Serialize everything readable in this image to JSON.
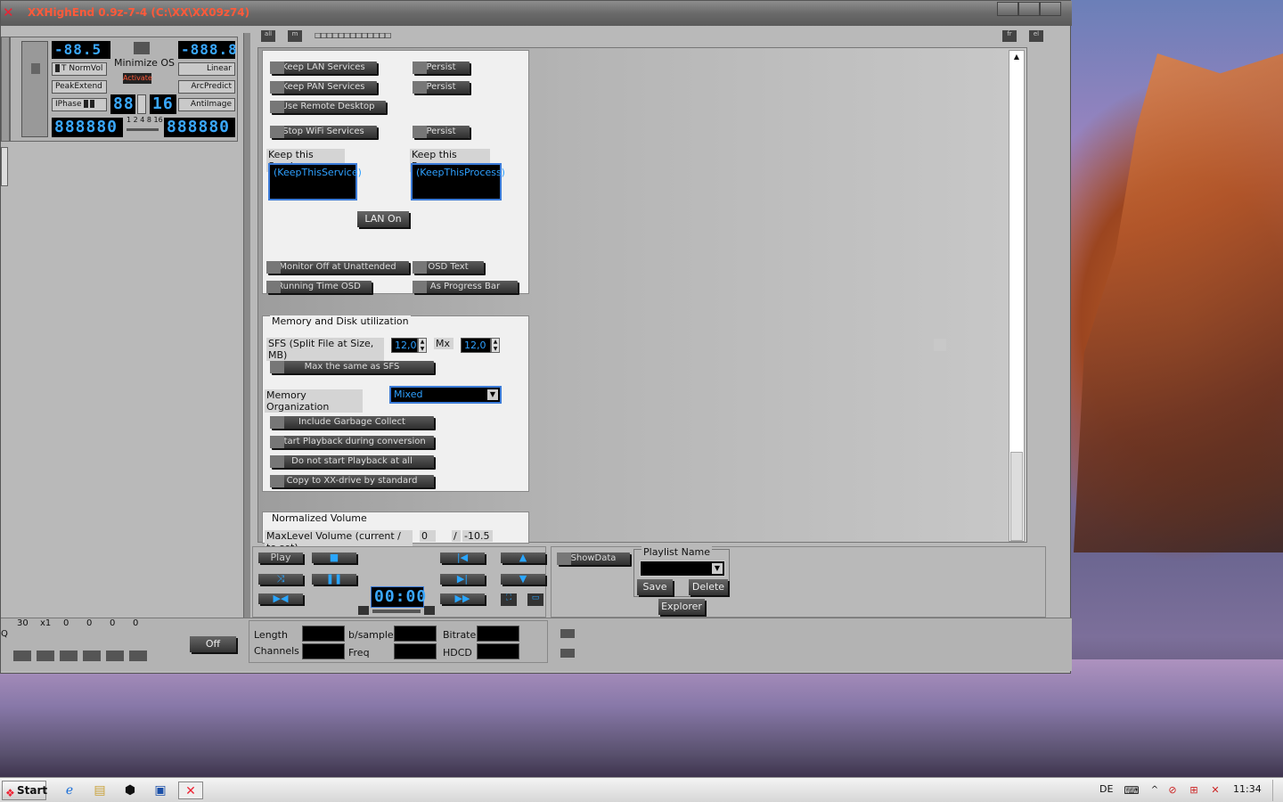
{
  "window": {
    "title": "XXHighEnd 0.9z-7-4 (C:\\XX\\XX09z74)"
  },
  "control_panel": {
    "lcd_top_left": "-88.5",
    "lcd_top_right": "-888.8",
    "normvol_label": "NormVol",
    "peakextend_label": "PeakExtend",
    "iphase_label": "IPhase",
    "minimize_os_label": "Minimize OS",
    "activate_label": "Activate",
    "linear_label": "Linear",
    "arcpredict_label": "ArcPredict",
    "antiimage_label": "AntiImage",
    "lcd_mid_left": "88",
    "lcd_mid_right": "16",
    "lcd_bottom_left": "888880",
    "lcd_bottom_right": "888880",
    "scale_marks": "1 2 4 8 16",
    "t_label": "T"
  },
  "toolbar": {
    "btn_a": "all",
    "btn_b": "m",
    "dotted": "□□□□□□□□□□□□□",
    "btn_c": "fr",
    "btn_d": "el"
  },
  "services": {
    "keep_lan": "Keep LAN Services",
    "keep_pan": "Keep PAN Services",
    "use_remote": "Use Remote Desktop",
    "stop_wifi": "Stop WiFi Services",
    "persist": "Persist",
    "keep_service_label": "Keep this Service",
    "keep_process_label": "Keep this Process",
    "keep_service_value": "(KeepThisService)",
    "keep_process_value": "(KeepThisProcess)",
    "lan_on": "LAN On",
    "monitor_off": "Monitor Off at Unattended",
    "osd_text": "OSD Text",
    "running_time": "Running Time OSD",
    "progress_bar": "As Progress Bar"
  },
  "memory": {
    "legend": "Memory and Disk utilization",
    "sfs_label": "SFS (Split File at Size, MB)",
    "sfs_value": "12,0",
    "mx_label": "Mx",
    "mx_value": "12,0",
    "max_same": "Max the same as SFS",
    "org_label": "Memory Organization",
    "org_value": "Mixed",
    "garbage": "Include Garbage Collect",
    "start_playback": "Start Playback during conversion",
    "no_playback": "Do not start Playback at all",
    "copy_xx": "Copy to XX-drive by standard"
  },
  "normalized": {
    "legend": "Normalized Volume",
    "maxlevel_label": "MaxLevel Volume (current / to set)",
    "current": "0",
    "sep": "/",
    "to_set": "-10.5"
  },
  "transport": {
    "play": "Play",
    "time": "00:00"
  },
  "playlist": {
    "showdata": "ShowData",
    "name_label": "Playlist Name",
    "save": "Save",
    "delete": "Delete",
    "explorer": "Explorer"
  },
  "bottom": {
    "eq_values": [
      "30",
      "x1",
      "0",
      "0",
      "0",
      "0"
    ],
    "off": "Off",
    "length": "Length",
    "channels": "Channels",
    "bsample": "b/sample",
    "freq": "Freq",
    "bitrate": "Bitrate",
    "hdcd": "HDCD",
    "q_label": "Q"
  },
  "taskbar": {
    "start": "Start",
    "lang": "DE",
    "clock": "11:34"
  }
}
